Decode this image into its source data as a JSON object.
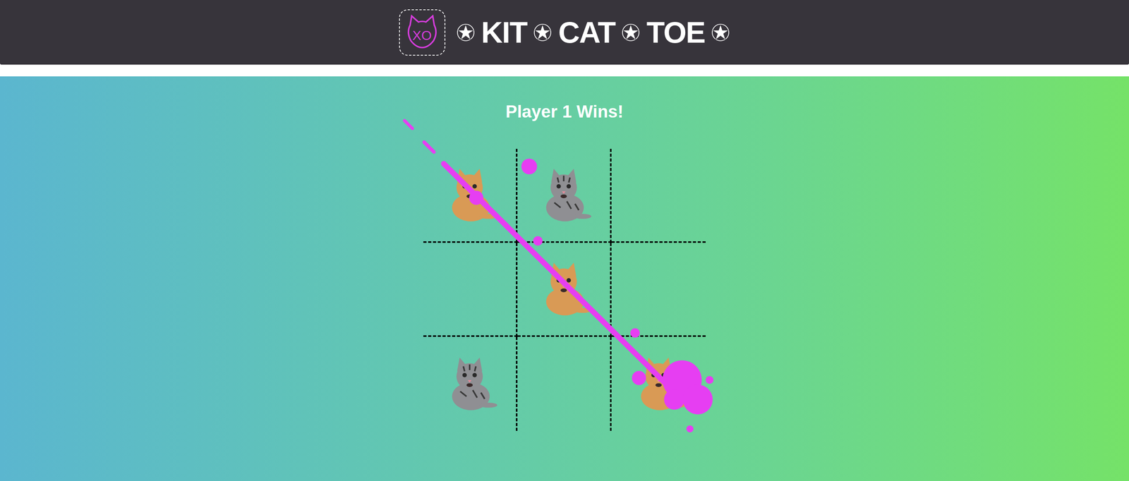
{
  "header": {
    "logo": {
      "text": "XO"
    },
    "title": [
      "KIT",
      "CAT",
      "TOE"
    ]
  },
  "status": "Player 1 Wins!",
  "players": [
    {
      "id": 1,
      "color": "#d99a55"
    },
    {
      "id": 2,
      "color": "#8f8f93"
    }
  ],
  "board": {
    "cells": [
      {
        "player": 1
      },
      {
        "player": 2
      },
      {
        "player": null
      },
      {
        "player": null
      },
      {
        "player": 1
      },
      {
        "player": null
      },
      {
        "player": 2
      },
      {
        "player": null
      },
      {
        "player": 1
      }
    ],
    "winning_line": [
      0,
      4,
      8
    ]
  }
}
